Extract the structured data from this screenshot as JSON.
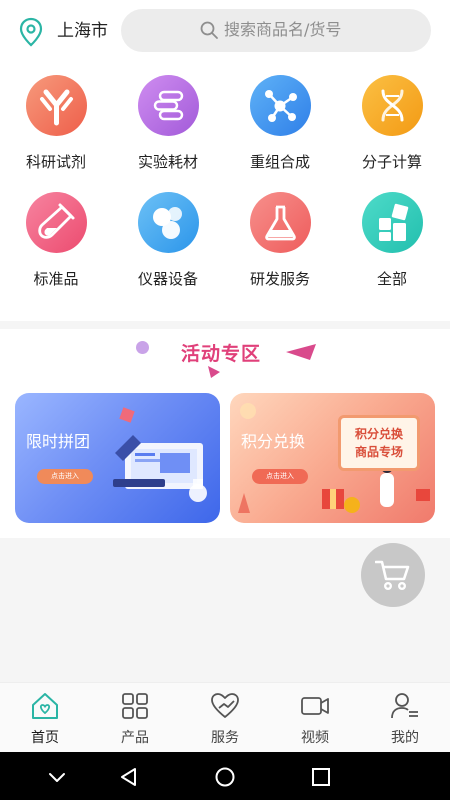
{
  "header": {
    "city": "上海市",
    "search_placeholder": "搜索商品名/货号"
  },
  "categories": [
    {
      "label": "科研试剂",
      "icon": "antibody-icon",
      "color": "#f06f5a"
    },
    {
      "label": "实验耗材",
      "icon": "consumables-icon",
      "color": "#b46be0"
    },
    {
      "label": "重组合成",
      "icon": "molecule-icon",
      "color": "#3a8ff0"
    },
    {
      "label": "分子计算",
      "icon": "dna-icon",
      "color": "#f5a31c"
    },
    {
      "label": "标准品",
      "icon": "test-tube-icon",
      "color": "#ef5a7c"
    },
    {
      "label": "仪器设备",
      "icon": "instrument-icon",
      "color": "#3aa6ee"
    },
    {
      "label": "研发服务",
      "icon": "flask-icon",
      "color": "#f06b6b"
    },
    {
      "label": "全部",
      "icon": "grid-all-icon",
      "color": "#2ec8b8"
    }
  ],
  "activity": {
    "title": "活动专区",
    "cards": [
      {
        "title": "限时拼团",
        "button": "点击进入"
      },
      {
        "title": "积分兑换",
        "button": "点击进入",
        "board_line1": "积分兑换",
        "board_line2": "商品专场"
      }
    ]
  },
  "bottom_nav": [
    {
      "label": "首页",
      "icon": "home-icon",
      "active": true
    },
    {
      "label": "产品",
      "icon": "grid-icon",
      "active": false
    },
    {
      "label": "服务",
      "icon": "heart-hand-icon",
      "active": false
    },
    {
      "label": "视频",
      "icon": "video-icon",
      "active": false
    },
    {
      "label": "我的",
      "icon": "user-icon",
      "active": false
    }
  ],
  "colors": {
    "accent": "#2bb5a5",
    "activity_title": "#e0407a"
  }
}
